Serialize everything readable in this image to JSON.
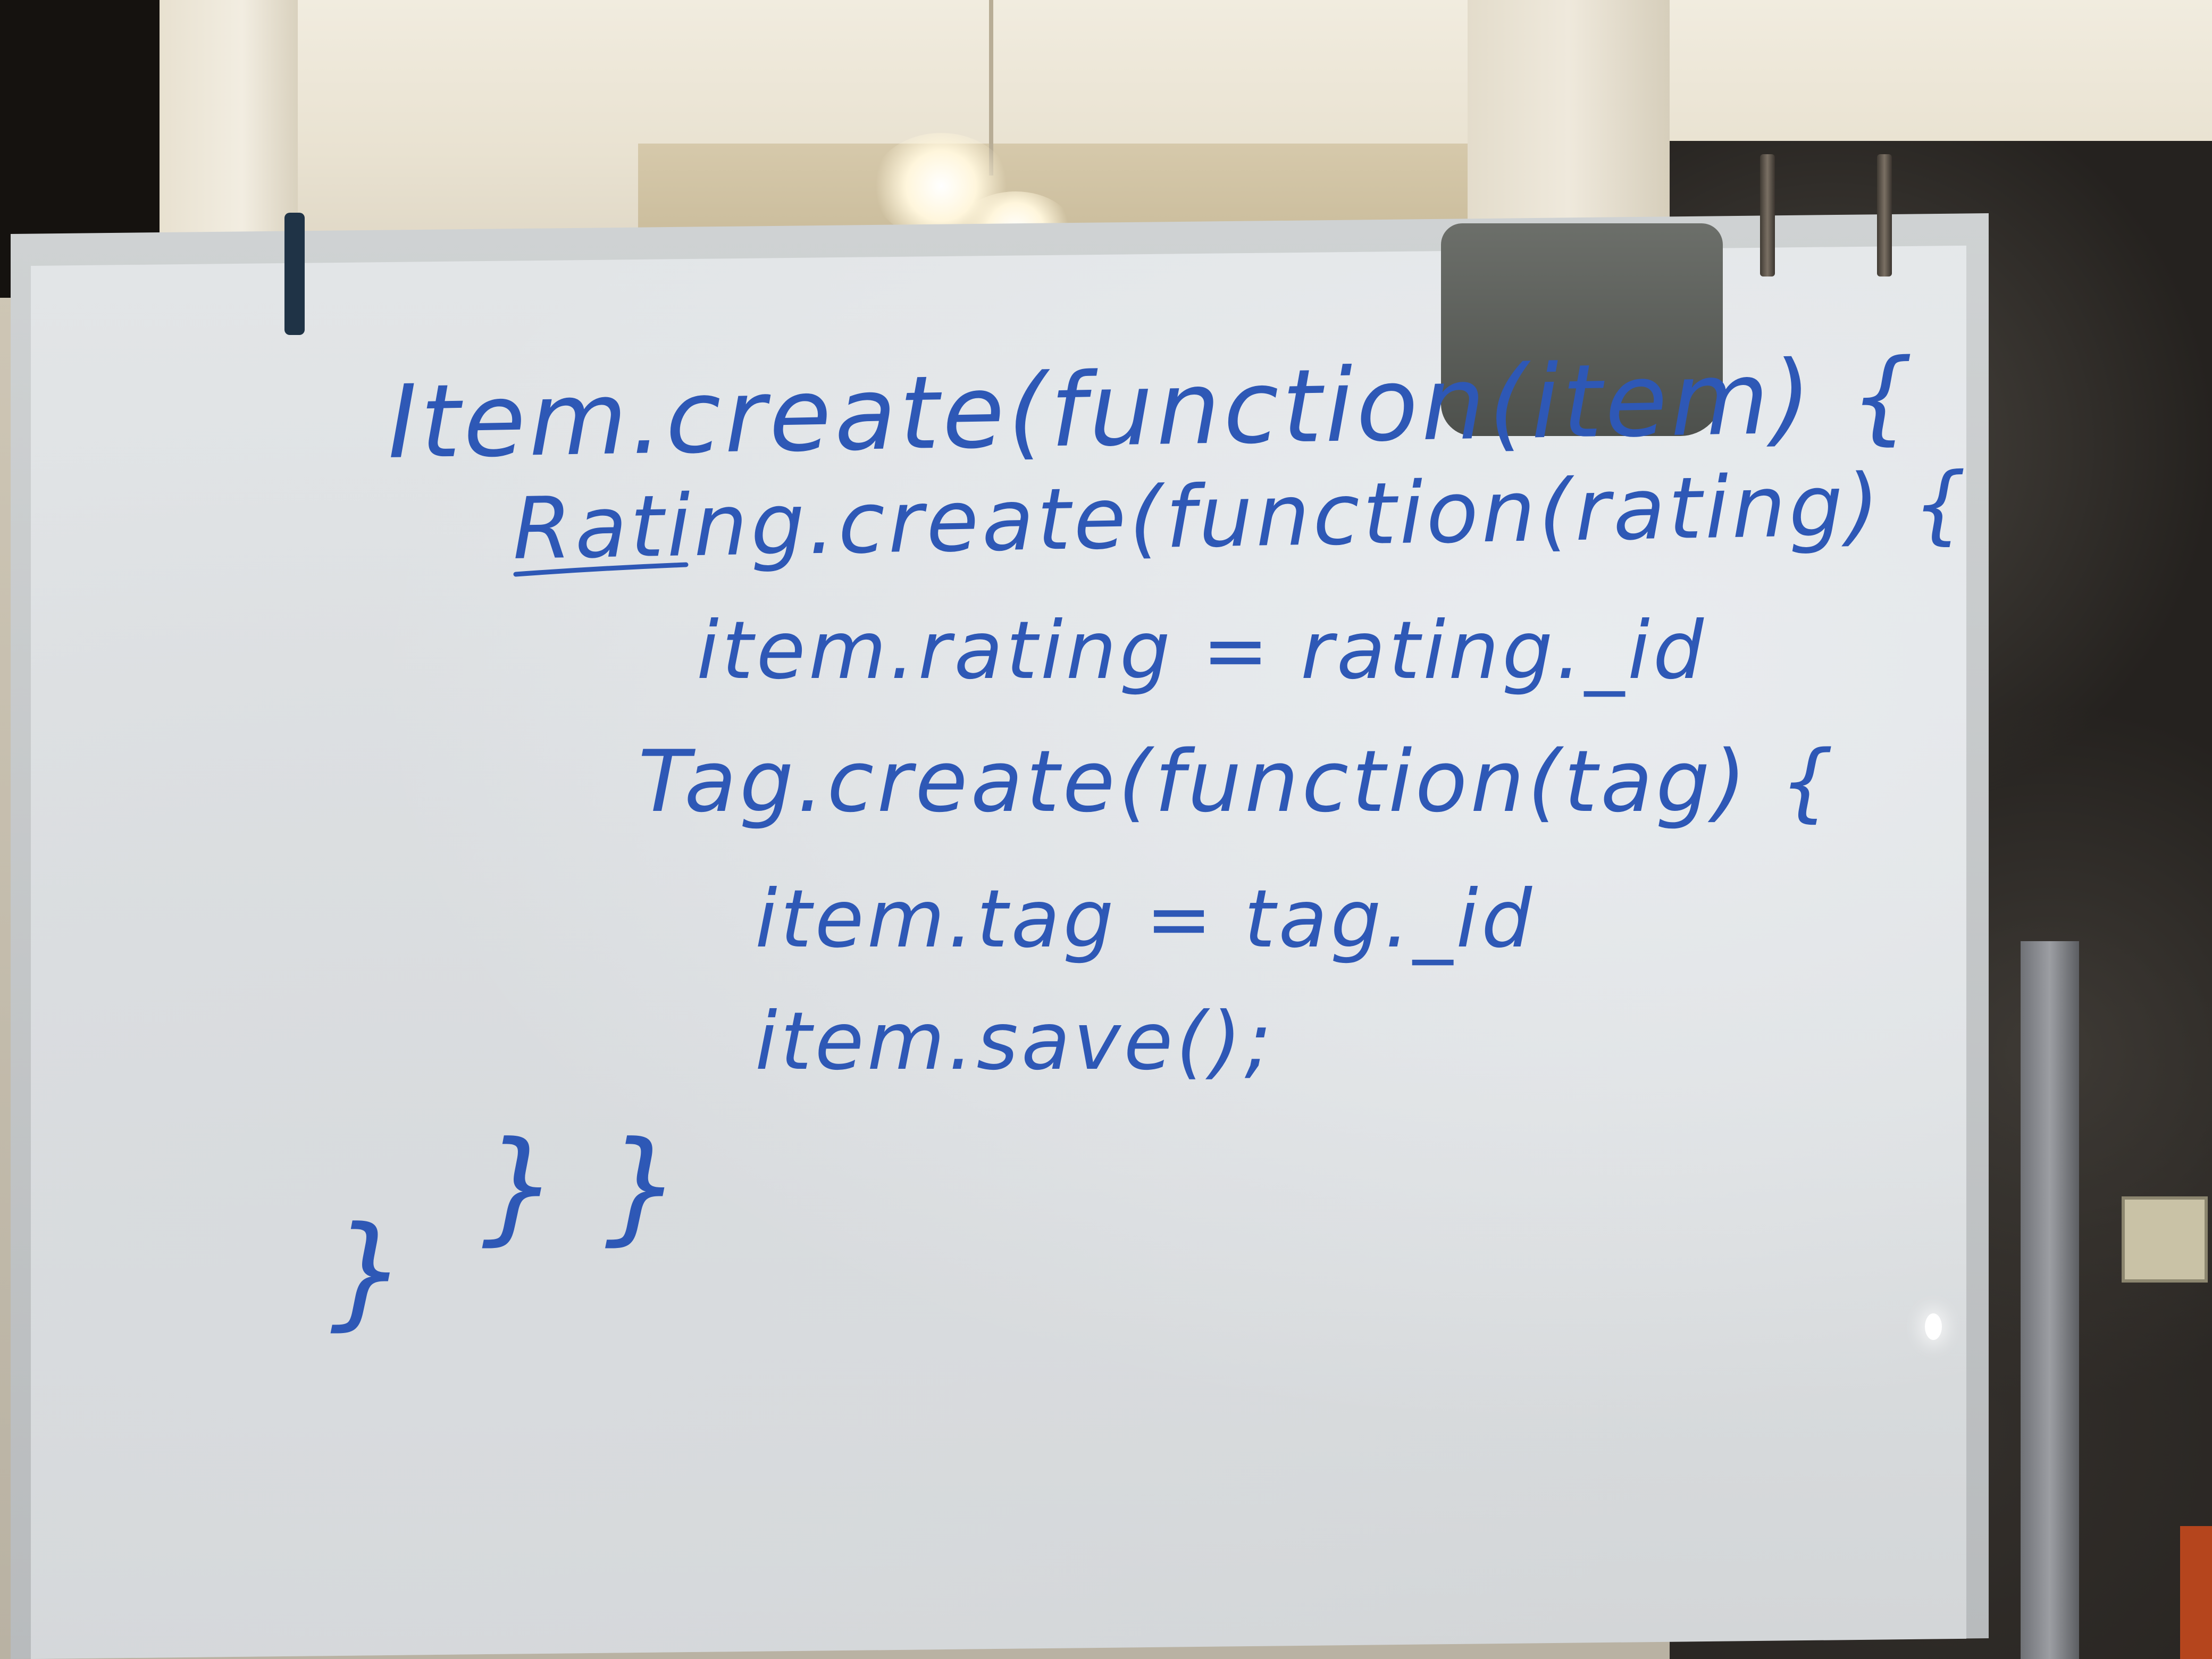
{
  "whiteboard": {
    "lines": [
      "Item.create(function(item) {",
      "Rating.create(function(rating) {",
      "item.rating = rating._id",
      "Tag.create(function(tag) {",
      "item.tag = tag._id",
      "item.save();",
      "} }",
      "}"
    ],
    "ink_color": "#2e58b6"
  }
}
